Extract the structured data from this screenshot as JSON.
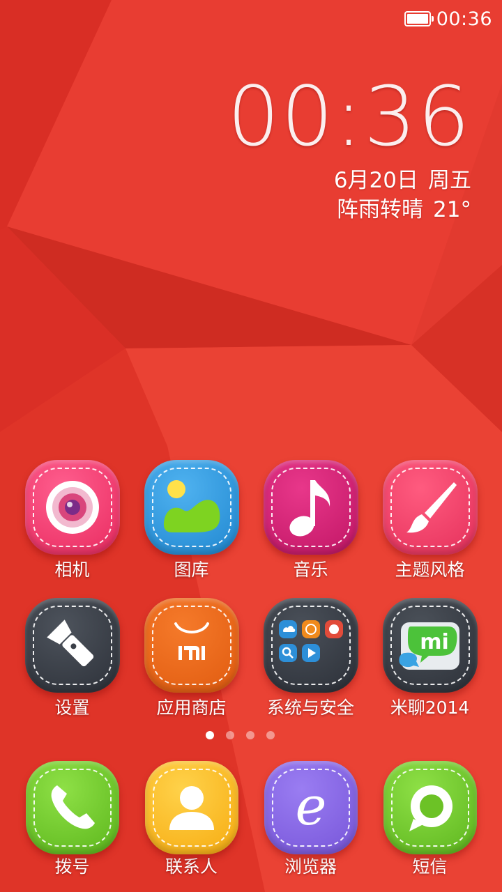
{
  "status_bar": {
    "time": "00:36"
  },
  "clock_widget": {
    "time": "00:36",
    "date": "6月20日",
    "weekday": "周五",
    "weather": "阵雨转晴",
    "temperature": "21°"
  },
  "apps": [
    {
      "label": "相机",
      "icon": "camera-icon",
      "color": "#e8295e"
    },
    {
      "label": "图库",
      "icon": "gallery-icon",
      "color": "#1f86cf"
    },
    {
      "label": "音乐",
      "icon": "music-note-icon",
      "color": "#c01564"
    },
    {
      "label": "主题风格",
      "icon": "paintbrush-icon",
      "color": "#e42f5a"
    },
    {
      "label": "设置",
      "icon": "flashlight-icon",
      "color": "#2c3038"
    },
    {
      "label": "应用商店",
      "icon": "mi-store-bag-icon",
      "color": "#e05a0f"
    },
    {
      "label": "系统与安全",
      "icon": "folder-icon",
      "color": "#2b2f37"
    },
    {
      "label": "米聊2014",
      "icon": "mi-chat-icon",
      "color": "#2c3038"
    }
  ],
  "dock": [
    {
      "label": "拨号",
      "icon": "phone-icon",
      "color": "#5bb51b"
    },
    {
      "label": "联系人",
      "icon": "contact-icon",
      "color": "#f6aa0f"
    },
    {
      "label": "浏览器",
      "icon": "browser-e-icon",
      "color": "#7654d8"
    },
    {
      "label": "短信",
      "icon": "message-bubble-icon",
      "color": "#5cb41d"
    }
  ],
  "page_indicator": {
    "pages": 4,
    "active": 1
  }
}
